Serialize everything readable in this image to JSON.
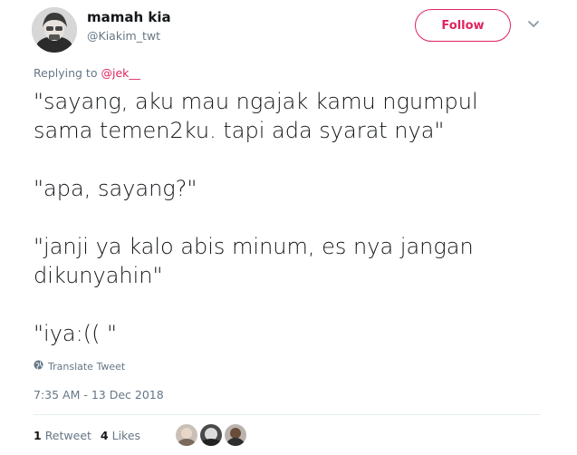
{
  "author": {
    "name": "mamah kia",
    "handle": "@Kiakim_twt"
  },
  "follow_label": "Follow",
  "replying": {
    "prefix": "Replying to",
    "mention": "@jek__"
  },
  "tweet_lines": {
    "l1": "\"sayang, aku mau ngajak kamu ngumpul",
    "l2": "sama temen2ku. tapi ada syarat nya\"",
    "l3": "\"apa, sayang?\"",
    "l4": "\"janji ya kalo abis minum, es nya jangan",
    "l5": "dikunyahin\"",
    "l6": "\"iya:(( \""
  },
  "translate_label": "Translate Tweet",
  "timestamp": "7:35 AM - 13 Dec 2018",
  "stats": {
    "retweets_count": "1",
    "retweets_label": "Retweet",
    "likes_count": "4",
    "likes_label": "Likes"
  },
  "colors": {
    "accent": "#e0245e",
    "secondary_text": "#657786",
    "divider": "#e6ecf0"
  },
  "icons": [
    "chevron-down-icon",
    "globe-icon"
  ]
}
